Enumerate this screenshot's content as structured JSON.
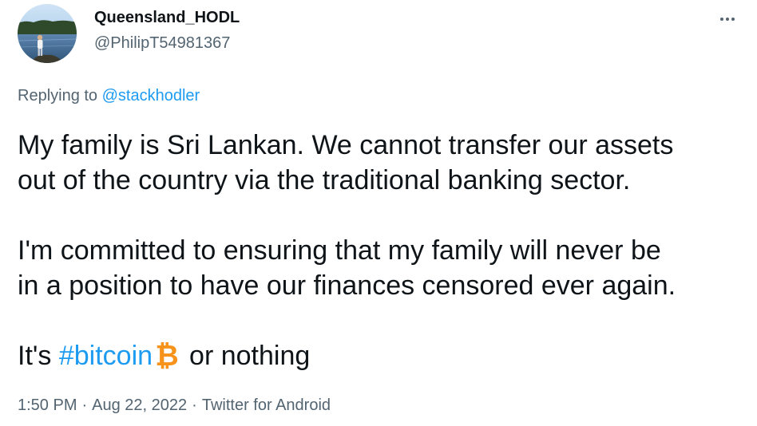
{
  "author": {
    "display_name": "Queensland_HODL",
    "handle": "@PhilipT54981367"
  },
  "reply": {
    "prefix": "Replying to",
    "mention": "@stackhodler"
  },
  "body": {
    "line1": "My family is Sri Lankan. We cannot transfer our assets",
    "line2": "out of the country via the traditional banking sector.",
    "line3": "I'm committed to ensuring that my family will never be",
    "line4": "in a position to have our finances censored ever again.",
    "line5_prefix": "It's",
    "hashtag": "#bitcoin",
    "emoji": "bitcoin-symbol-icon",
    "line5_suffix": "or nothing"
  },
  "meta": {
    "time": "1:50 PM",
    "date": "Aug 22, 2022",
    "source": "Twitter for Android",
    "separator": "·"
  },
  "icons": {
    "more": "more-dots-icon"
  },
  "colors": {
    "link": "#1d9bf0",
    "secondary_text": "#536471",
    "primary_text": "#0f1419",
    "bitcoin_orange": "#f7931a"
  }
}
